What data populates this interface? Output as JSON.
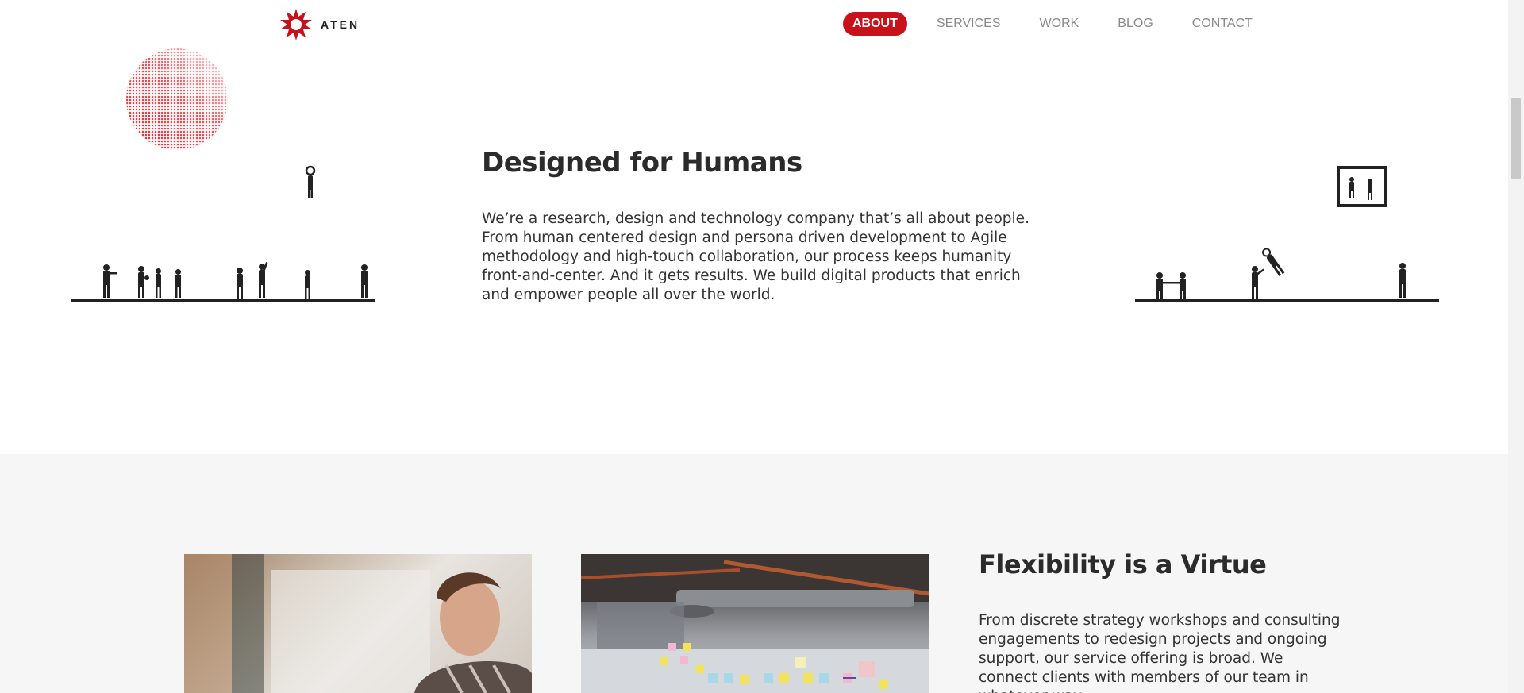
{
  "header": {
    "logo_text": "ATEN",
    "nav": [
      {
        "label": "ABOUT",
        "active": true
      },
      {
        "label": "SERVICES",
        "active": false
      },
      {
        "label": "WORK",
        "active": false
      },
      {
        "label": "BLOG",
        "active": false
      },
      {
        "label": "CONTACT",
        "active": false
      }
    ]
  },
  "section_humans": {
    "title": "Designed for Humans",
    "body": "We’re a research, design and technology company that’s all about people. From human centered design and persona driven development to Agile methodology and high-touch collaboration, our process keeps humanity front-and-center. And it gets results. We build digital products that enrich and empower people all over the world."
  },
  "section_flexibility": {
    "title": "Flexibility is a Virtue",
    "body": "From discrete strategy workshops and consulting engagements to redesign projects and ongoing support, our service offering is broad. We connect clients with members of our team in whatever way"
  },
  "colors": {
    "brand_red": "#c8111a",
    "text_dark": "#2b2b2b",
    "section_gray": "#f6f6f6"
  },
  "icons": [
    "aten-logo-icon",
    "halftone-circle",
    "people-silhouettes-left",
    "people-silhouettes-right",
    "framed-picture-icon"
  ]
}
